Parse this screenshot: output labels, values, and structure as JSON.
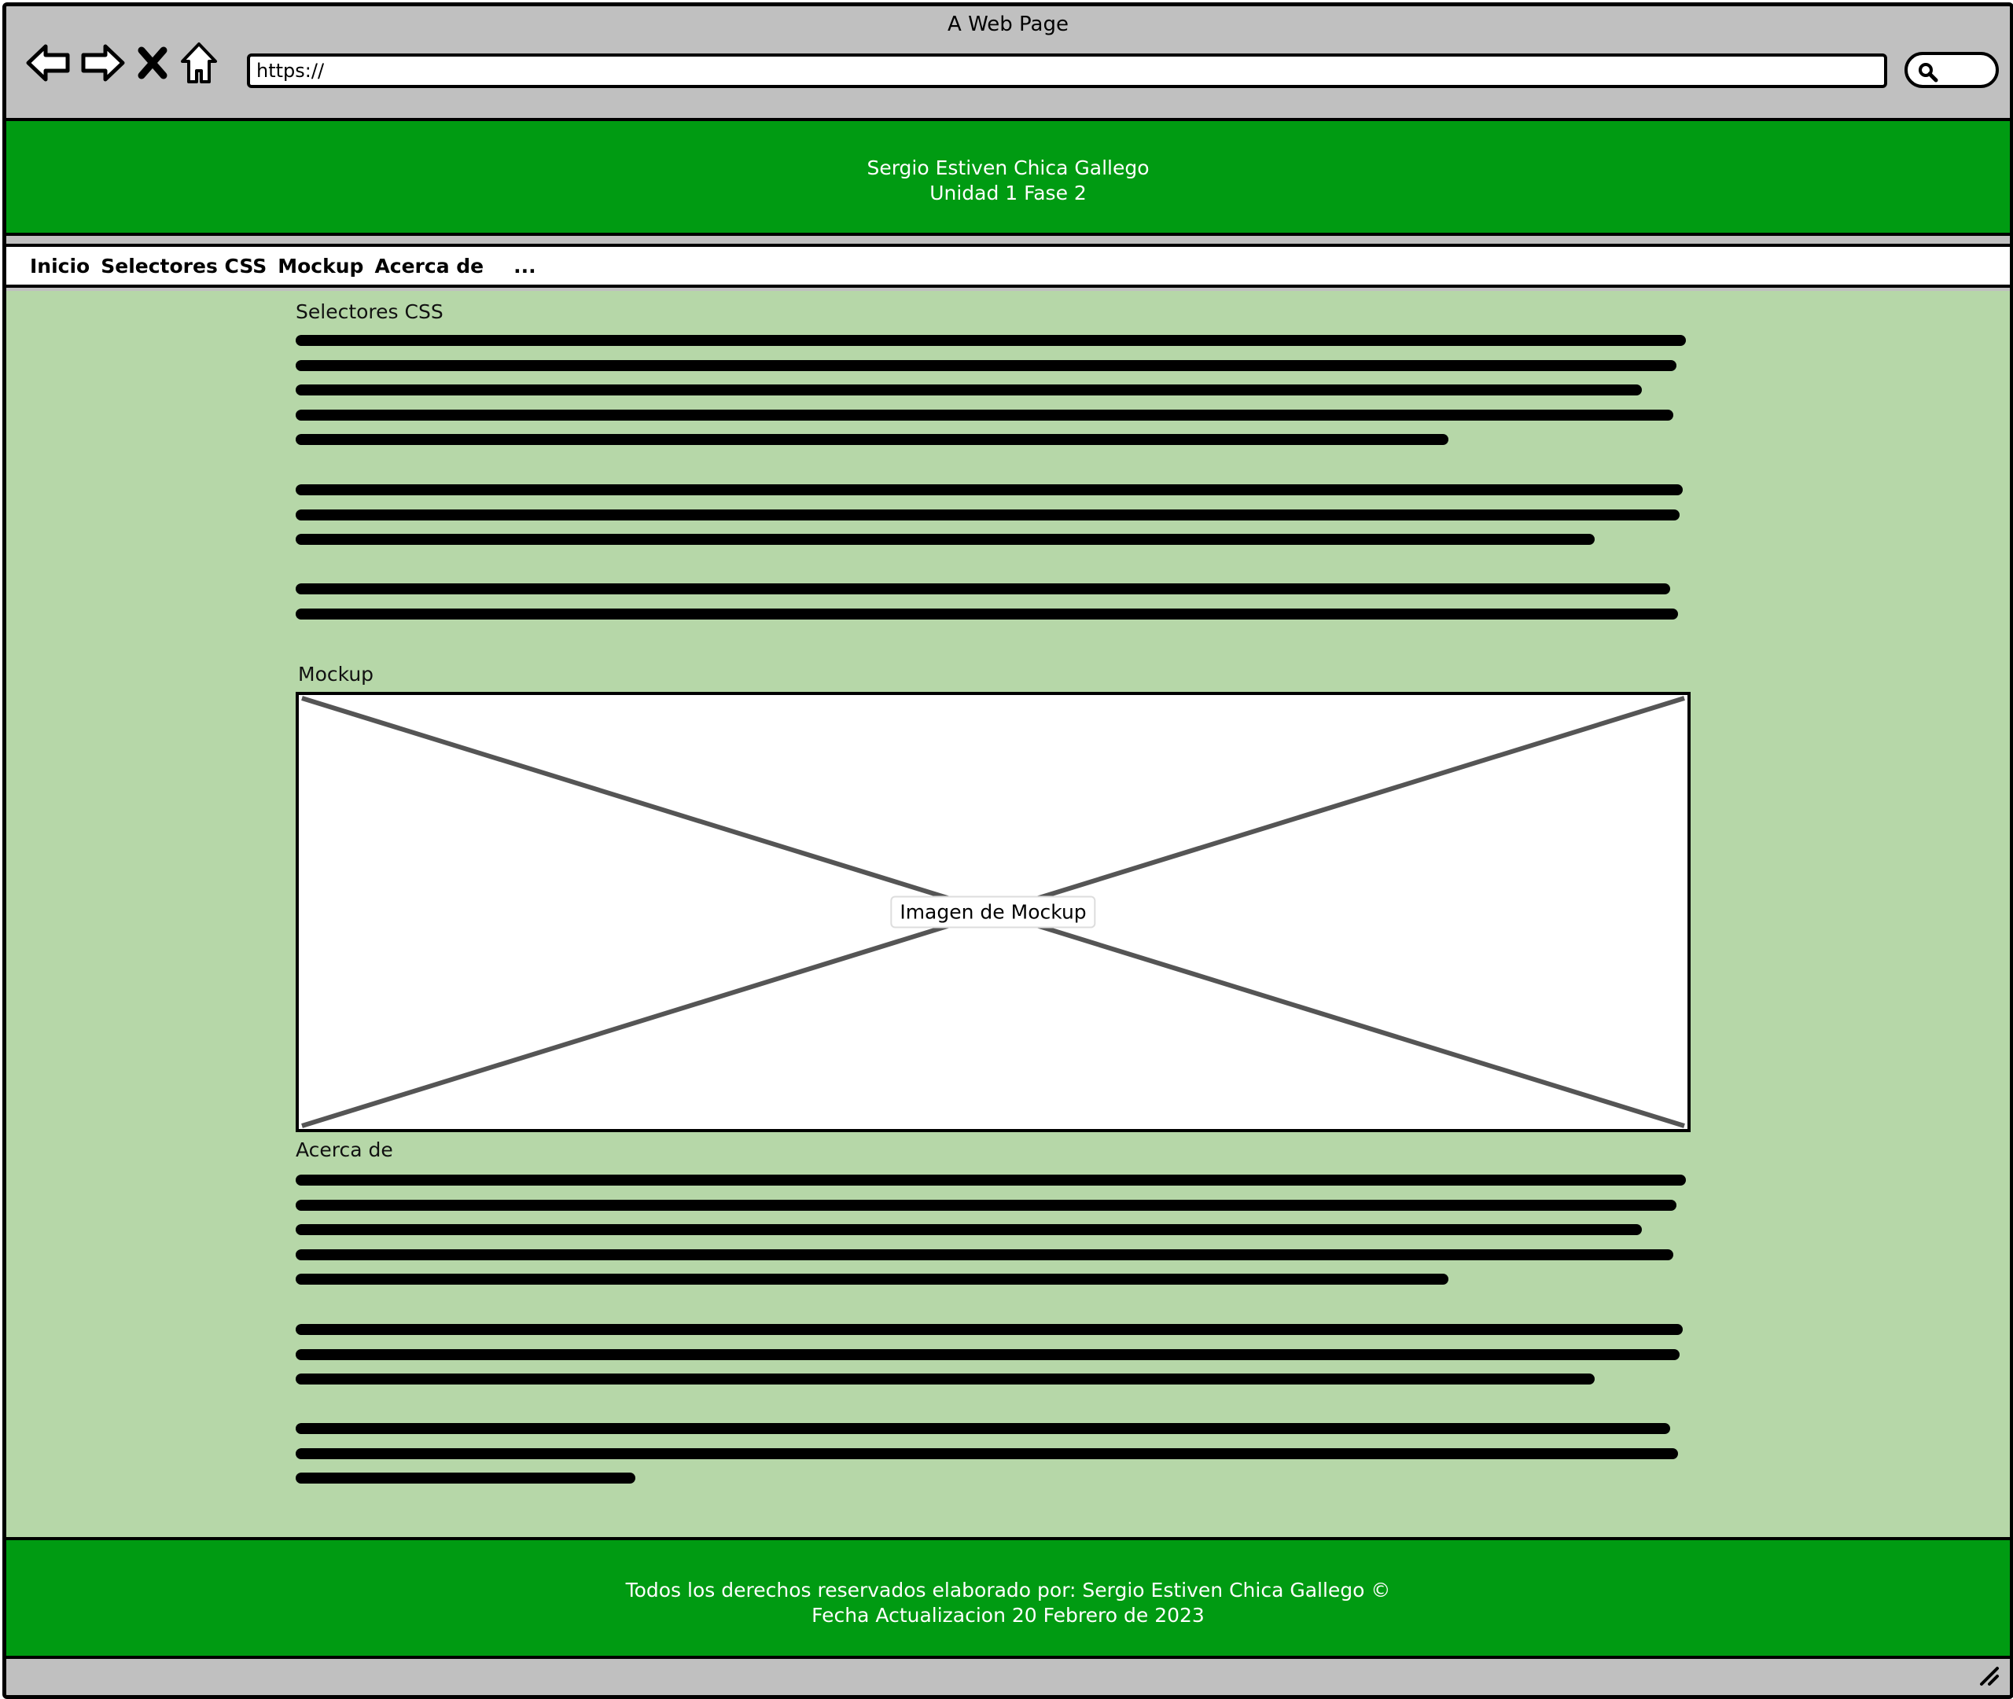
{
  "window": {
    "title": "A Web Page",
    "url": "https://"
  },
  "header": {
    "line1": "Sergio Estiven Chica Gallego",
    "line2": "Unidad 1 Fase 2"
  },
  "nav": {
    "items": [
      {
        "label": "Inicio"
      },
      {
        "label": "Selectores CSS"
      },
      {
        "label": "Mockup"
      },
      {
        "label": "Acerca de"
      }
    ],
    "more": "..."
  },
  "sections": {
    "selectores": {
      "title": "Selectores CSS"
    },
    "mockup": {
      "title": "Mockup",
      "image_label": "Imagen de Mockup"
    },
    "acerca": {
      "title": "Acerca de"
    }
  },
  "footer": {
    "line1": "Todos los derechos reservados elaborado por:  Sergio Estiven Chica Gallego ©",
    "line2": "Fecha Actualizacion 20 Febrero de 2023"
  },
  "colors": {
    "chrome": "#c0c0c0",
    "header_green": "#009b12",
    "content_green": "#b6d7a8"
  },
  "icons": [
    "back-arrow-icon",
    "forward-arrow-icon",
    "stop-icon",
    "home-icon",
    "search-icon",
    "resize-grip-icon"
  ]
}
